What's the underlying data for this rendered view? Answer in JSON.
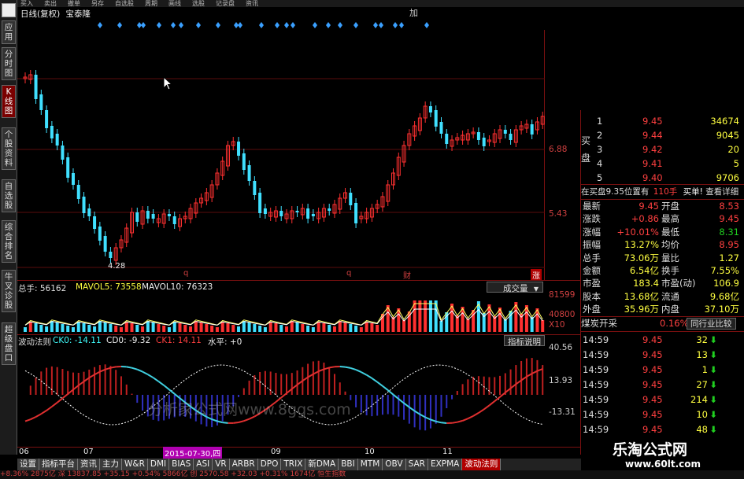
{
  "top_menu": [
    "买入",
    "卖出",
    "撤单",
    "另存",
    "自选股",
    "周期",
    "画线",
    "选股",
    "记录盘",
    "资讯"
  ],
  "top_right_text": "加",
  "left_tabs": [
    "应用",
    "分时图",
    "K线图",
    "个股资料",
    "自选股",
    "综合排名",
    "牛叉诊股",
    "超级盘口"
  ],
  "main": {
    "title": "日线(复权)",
    "title_tag": "宝泰隆",
    "price_labels": [
      "6.88",
      "5.43"
    ],
    "low_label": "4.28",
    "marker_labels": [
      "q",
      "q",
      "财",
      "涨"
    ]
  },
  "volume": {
    "total_label": "总手: 56162",
    "ma5_label": "MAVOL5: 73558",
    "ma10_label": "MAVOL10: 76323",
    "dropdown_label": "成交量",
    "axis": [
      "81599",
      "40800",
      "X10"
    ]
  },
  "indicator": {
    "name": "波动法则",
    "ck0": "CK0: -14.11",
    "cd0": "CD0: -9.32",
    "ck1": "CK1: 14.11",
    "level": "水平: +0",
    "explain_button": "指标说明",
    "axis": [
      "40.56",
      "13.93",
      "-13.31"
    ],
    "watermark": "分析家公式网www.8ggs.com"
  },
  "date_axis": {
    "labels": [
      "06",
      "07",
      "09",
      "10",
      "11"
    ],
    "highlight": "2015-07-30,四"
  },
  "quote": {
    "bid_side": "买盘",
    "bids": [
      {
        "lvl": "1",
        "price": "9.45",
        "vol": "34674"
      },
      {
        "lvl": "2",
        "price": "9.44",
        "vol": "9045"
      },
      {
        "lvl": "3",
        "price": "9.42",
        "vol": "20"
      },
      {
        "lvl": "4",
        "price": "9.41",
        "vol": "5"
      },
      {
        "lvl": "5",
        "price": "9.40",
        "vol": "9706"
      }
    ],
    "info_left": "在买盘9.35位置有",
    "info_mid": "110手",
    "info_right": "买单!",
    "info_link": "查看详细",
    "stats": [
      {
        "k1": "最新",
        "v1": "9.45",
        "k2": "开盘",
        "v2": "8.53"
      },
      {
        "k1": "涨跌",
        "v1": "+0.86",
        "k2": "最高",
        "v2": "9.45"
      },
      {
        "k1": "涨幅",
        "v1": "+10.01%",
        "k2": "最低",
        "v2": "8.31"
      },
      {
        "k1": "振幅",
        "v1": "13.27%",
        "k2": "均价",
        "v2": "8.95"
      },
      {
        "k1": "总手",
        "v1": "73.06万",
        "k2": "量比",
        "v2": "1.27"
      },
      {
        "k1": "金额",
        "v1": "6.54亿",
        "k2": "换手",
        "v2": "7.55%"
      },
      {
        "k1": "市盈",
        "v1": "183.4",
        "k2": "市盈(动)",
        "v2": "106.9"
      },
      {
        "k1": "股本",
        "v1": "13.68亿",
        "k2": "流通",
        "v2": "9.68亿"
      },
      {
        "k1": "外盘",
        "v1": "35.96万",
        "k2": "内盘",
        "v2": "37.10万"
      }
    ],
    "sector": "煤炭开采",
    "sector_pct": "0.16%",
    "sector_button": "同行业比较",
    "ticks": [
      {
        "t": "14:59",
        "p": "9.45",
        "v": "32"
      },
      {
        "t": "14:59",
        "p": "9.45",
        "v": "13"
      },
      {
        "t": "14:59",
        "p": "9.45",
        "v": "1"
      },
      {
        "t": "14:59",
        "p": "9.45",
        "v": "27"
      },
      {
        "t": "14:59",
        "p": "9.45",
        "v": "214"
      },
      {
        "t": "14:59",
        "p": "9.45",
        "v": "10"
      },
      {
        "t": "14:59",
        "p": "9.45",
        "v": "48"
      }
    ]
  },
  "bottom_tabs": [
    "设置",
    "指标平台",
    "资讯",
    "主力",
    "W&R",
    "DMI",
    "BIAS",
    "ASI",
    "VR",
    "ARBR",
    "DPO",
    "TRIX",
    "新DMA",
    "BBI",
    "MTM",
    "OBV",
    "SAR",
    "EXPMA",
    "波动法则"
  ],
  "status_bar": "+8.36%   2875亿 深   13837.85  +35.15  +0.54%   5866亿 创   2570.58  +32.03  +0.31%  1674亿 恒生指数",
  "brand": {
    "name": "乐淘公式网",
    "url": "www.60lt.com"
  },
  "colors": {
    "up": "#ff3030",
    "down": "#40e0ff",
    "frame": "#7a1010",
    "accent": "#b00000"
  }
}
